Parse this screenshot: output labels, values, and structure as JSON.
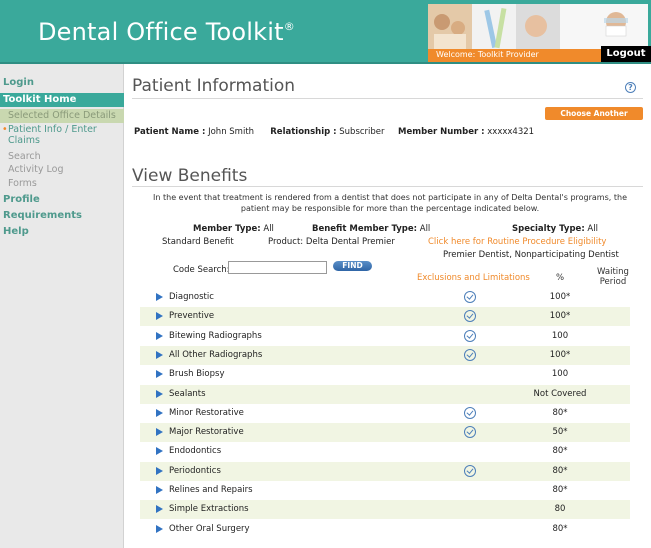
{
  "header": {
    "title": "Dental Office Toolkit",
    "trademark": "®",
    "welcome": "Welcome: Toolkit Provider",
    "logout": "Logout"
  },
  "sidebar": {
    "items": [
      {
        "label": "Login"
      },
      {
        "label": "Toolkit Home"
      },
      {
        "label": "Selected Office Details"
      },
      {
        "label": "Patient Info / Enter Claims"
      },
      {
        "label": "Search"
      },
      {
        "label": "Activity Log"
      },
      {
        "label": "Forms"
      },
      {
        "label": "Profile"
      },
      {
        "label": "Requirements"
      },
      {
        "label": "Help"
      }
    ]
  },
  "page": {
    "title": "Patient Information",
    "help": "?",
    "choose_button": "Choose Another Patient",
    "patient": {
      "name_label": "Patient Name :",
      "name_value": "John Smith",
      "relationship_label": "Relationship :",
      "relationship_value": "Subscriber",
      "member_label": "Member Number :",
      "member_value": "xxxxx4321"
    }
  },
  "benefits": {
    "title": "View Benefits",
    "disclaimer": "In the event that treatment is rendered from a dentist that does not participate in any of Delta Dental's programs, the patient may be responsible for more than the percentage indicated below.",
    "member_type_label": "Member Type:",
    "member_type_value": "All",
    "benefit_member_type_label": "Benefit Member Type:",
    "benefit_member_type_value": "All",
    "specialty_type_label": "Specialty Type:",
    "specialty_type_value": "All",
    "standard_benefit": "Standard Benefit",
    "product": "Product: Delta Dental Premier",
    "eligibility_link": "Click here for Routine Procedure Eligibility",
    "network": "Premier Dentist, Nonparticipating Dentist",
    "code_search_label": "Code Search:",
    "code_search_value": "",
    "find_button": "FIND",
    "col_exclusions": "Exclusions and Limitations",
    "col_percent": "%",
    "col_waiting": "Waiting Period",
    "rows": [
      {
        "name": "Diagnostic",
        "excl": true,
        "pct": "100*",
        "wait": ""
      },
      {
        "name": "Preventive",
        "excl": true,
        "pct": "100*",
        "wait": ""
      },
      {
        "name": "Bitewing Radiographs",
        "excl": true,
        "pct": "100",
        "wait": ""
      },
      {
        "name": "All Other Radiographs",
        "excl": true,
        "pct": "100*",
        "wait": ""
      },
      {
        "name": "Brush Biopsy",
        "excl": false,
        "pct": "100",
        "wait": ""
      },
      {
        "name": "Sealants",
        "excl": false,
        "pct": "Not Covered",
        "wait": ""
      },
      {
        "name": "Minor Restorative",
        "excl": true,
        "pct": "80*",
        "wait": ""
      },
      {
        "name": "Major Restorative",
        "excl": true,
        "pct": "50*",
        "wait": ""
      },
      {
        "name": "Endodontics",
        "excl": false,
        "pct": "80*",
        "wait": ""
      },
      {
        "name": "Periodontics",
        "excl": true,
        "pct": "80*",
        "wait": ""
      },
      {
        "name": "Relines and Repairs",
        "excl": false,
        "pct": "80*",
        "wait": ""
      },
      {
        "name": "Simple Extractions",
        "excl": false,
        "pct": "80",
        "wait": ""
      },
      {
        "name": "Other Oral Surgery",
        "excl": false,
        "pct": "80*",
        "wait": ""
      }
    ]
  }
}
